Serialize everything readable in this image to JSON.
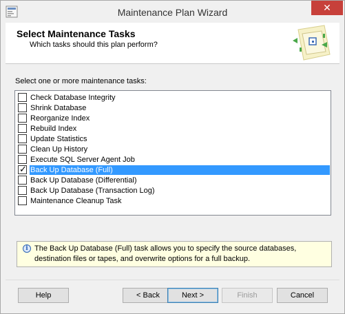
{
  "window": {
    "title": "Maintenance Plan Wizard",
    "close_glyph": "✕"
  },
  "header": {
    "title": "Select Maintenance Tasks",
    "subtitle": "Which tasks should this plan perform?",
    "icon": "wizard-illustration-icon"
  },
  "content": {
    "prompt": "Select one or more maintenance tasks:",
    "tasks": [
      {
        "label": "Check Database Integrity",
        "checked": false
      },
      {
        "label": "Shrink Database",
        "checked": false
      },
      {
        "label": "Reorganize Index",
        "checked": false
      },
      {
        "label": "Rebuild Index",
        "checked": false
      },
      {
        "label": "Update Statistics",
        "checked": false
      },
      {
        "label": "Clean Up History",
        "checked": false
      },
      {
        "label": "Execute SQL Server Agent Job",
        "checked": false
      },
      {
        "label": "Back Up Database (Full)",
        "checked": true,
        "selected": true
      },
      {
        "label": "Back Up Database (Differential)",
        "checked": false
      },
      {
        "label": "Back Up Database (Transaction Log)",
        "checked": false
      },
      {
        "label": "Maintenance Cleanup Task",
        "checked": false
      }
    ],
    "check_mark": "✓",
    "info_icon_glyph": "i",
    "info_text": "The Back Up Database (Full) task allows you to specify the source databases, destination files or tapes, and overwrite options for a full backup."
  },
  "footer": {
    "help_label": "Help",
    "back_label": "< Back",
    "next_label": "Next >",
    "finish_label": "Finish",
    "cancel_label": "Cancel"
  },
  "colors": {
    "selection": "#3399ff",
    "info_background": "#ffffe1",
    "close_button": "#c7403a"
  }
}
